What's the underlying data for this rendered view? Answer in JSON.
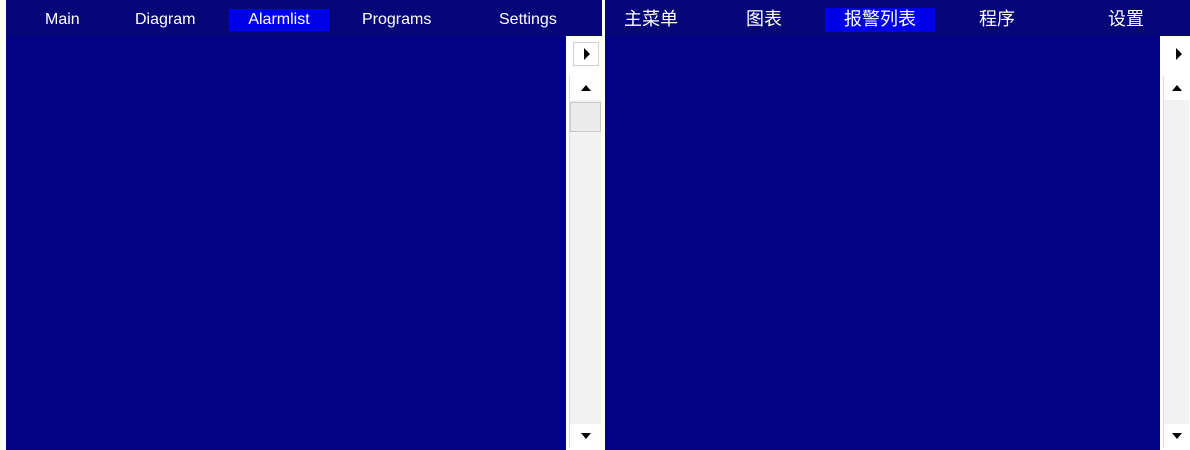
{
  "panels": [
    {
      "tabs": [
        {
          "label": "Main"
        },
        {
          "label": "Diagram"
        },
        {
          "label": "Alarmlist",
          "active": true
        },
        {
          "label": "Programs"
        },
        {
          "label": "Settings"
        }
      ]
    },
    {
      "tabs": [
        {
          "label": "主菜单"
        },
        {
          "label": "图表"
        },
        {
          "label": "报警列表",
          "active": true
        },
        {
          "label": "程序"
        },
        {
          "label": "设置"
        }
      ]
    }
  ],
  "colors": {
    "tabbar_background": "#060678",
    "content_background": "#020285",
    "active_tab": "#0000e8",
    "tab_text": "#ffffff"
  },
  "icons": [
    "arrow-right-icon",
    "arrow-up-icon",
    "arrow-down-icon"
  ]
}
